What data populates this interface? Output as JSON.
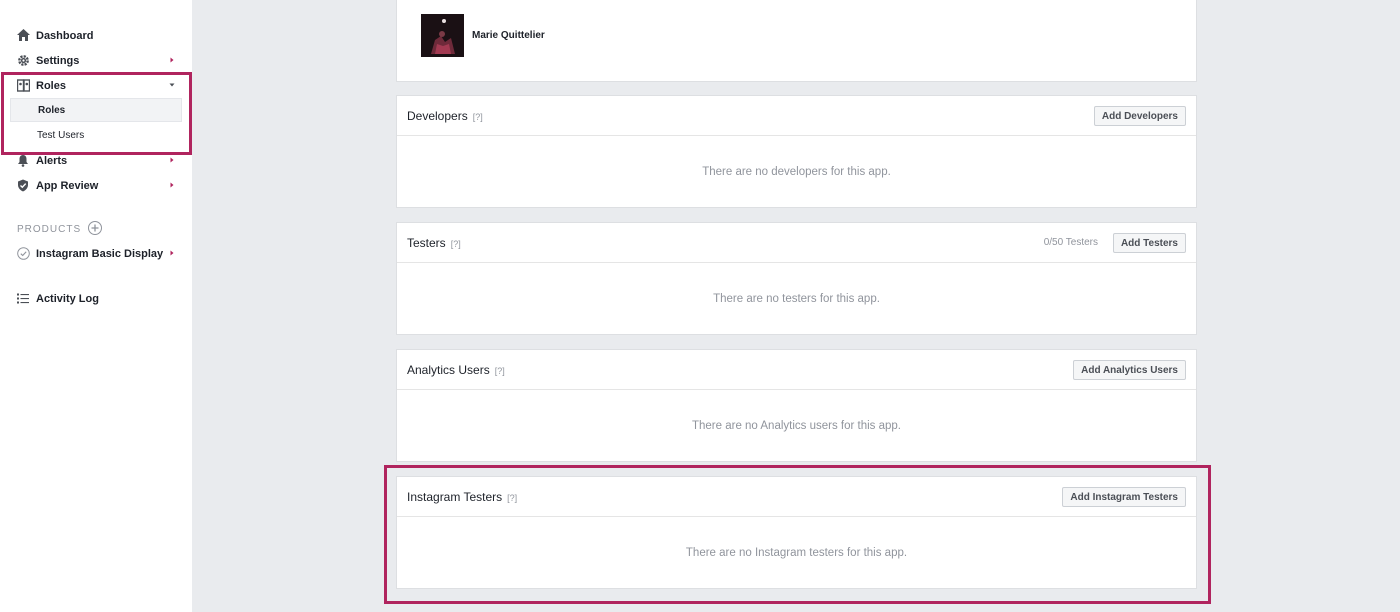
{
  "sidebar": {
    "items": [
      {
        "label": "Dashboard",
        "icon": "home-icon"
      },
      {
        "label": "Settings",
        "icon": "gear-icon"
      },
      {
        "label": "Roles",
        "icon": "roles-icon"
      },
      {
        "label": "Alerts",
        "icon": "bell-icon"
      },
      {
        "label": "App Review",
        "icon": "shield-check-icon"
      }
    ],
    "roles_subitems": [
      {
        "label": "Roles",
        "active": true
      },
      {
        "label": "Test Users",
        "active": false
      }
    ],
    "products_header": "PRODUCTS",
    "products": [
      {
        "label": "Instagram Basic Display",
        "icon": "check-circle-icon"
      }
    ],
    "activity_log": {
      "label": "Activity Log",
      "icon": "list-icon"
    }
  },
  "admin": {
    "name": "Marie Quittelier"
  },
  "sections": [
    {
      "title": "Developers",
      "help": "[?]",
      "button": "Add Developers",
      "counter": "",
      "empty": "There are no developers for this app."
    },
    {
      "title": "Testers",
      "help": "[?]",
      "button": "Add Testers",
      "counter": "0/50 Testers",
      "empty": "There are no testers for this app."
    },
    {
      "title": "Analytics Users",
      "help": "[?]",
      "button": "Add Analytics Users",
      "counter": "",
      "empty": "There are no Analytics users for this app."
    },
    {
      "title": "Instagram Testers",
      "help": "[?]",
      "button": "Add Instagram Testers",
      "counter": "",
      "empty": "There are no Instagram testers for this app."
    }
  ],
  "colors": {
    "highlight": "#b0245e",
    "background": "#e9ebee",
    "text": "#1d2129",
    "muted": "#90949c"
  }
}
